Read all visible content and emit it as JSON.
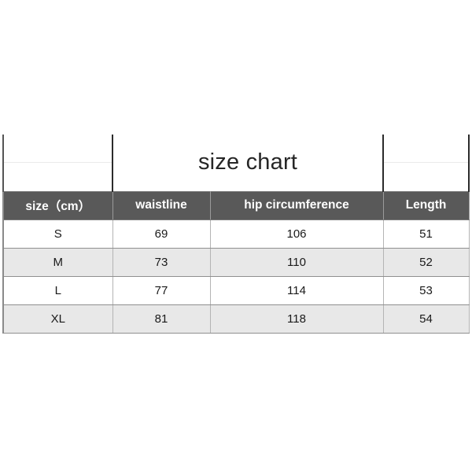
{
  "chart_data": {
    "type": "table",
    "title": "size chart",
    "unit_note": "cm",
    "columns": [
      "size（cm）",
      "waistline",
      "hip circumference",
      "Length"
    ],
    "rows": [
      {
        "size": "S",
        "waistline": "69",
        "hip_circumference": "106",
        "length": "51"
      },
      {
        "size": "M",
        "waistline": "73",
        "hip_circumference": "110",
        "length": "52"
      },
      {
        "size": "L",
        "waistline": "77",
        "hip_circumference": "114",
        "length": "53"
      },
      {
        "size": "XL",
        "waistline": "81",
        "hip_circumference": "118",
        "length": "54"
      }
    ],
    "colors": {
      "header_background": "#595959",
      "header_text": "#ffffff",
      "row_alt_background": "#e8e8e8",
      "row_background": "#ffffff",
      "title_text": "#262626",
      "border": "#8f8f8f",
      "page_background": "#ffffff"
    }
  }
}
